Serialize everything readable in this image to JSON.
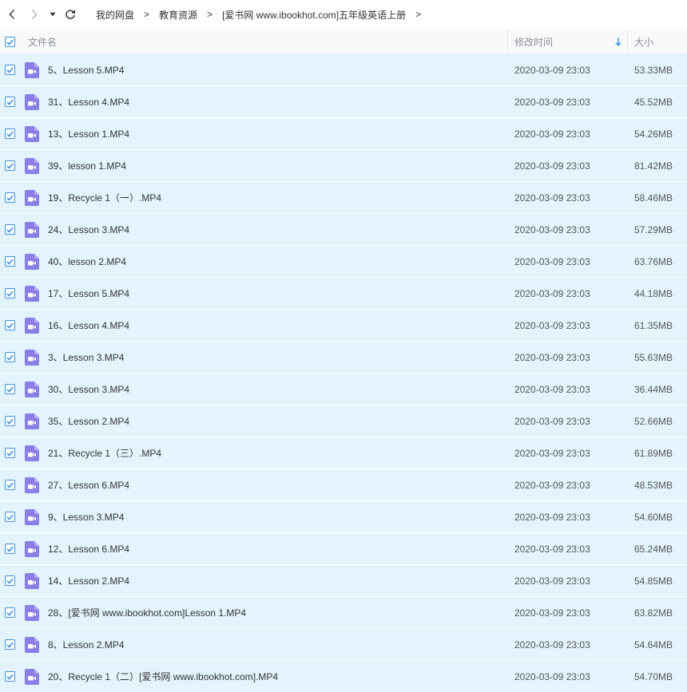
{
  "nav": {
    "back_icon": "chevron-left-icon",
    "forward_icon": "chevron-right-icon",
    "history_icon": "caret-down-icon",
    "refresh_icon": "refresh-icon"
  },
  "breadcrumb": {
    "items": [
      "我的网盘",
      "教育资源",
      "[爱书网 www.ibookhot.com]五年级英语上册"
    ],
    "separator": ">"
  },
  "columns": {
    "name": "文件名",
    "mtime": "修改时间",
    "size": "大小",
    "sort_icon": "arrow-down-icon"
  },
  "colors": {
    "row_selected_bg": "#e3f4fd",
    "checkbox": "#3b8fe0",
    "video_icon": "#8a7fe6",
    "sort_arrow": "#3b8fe0"
  },
  "files": [
    {
      "name": "5、Lesson 5.MP4",
      "mtime": "2020-03-09 23:03",
      "size": "53.33MB"
    },
    {
      "name": "31、Lesson 4.MP4",
      "mtime": "2020-03-09 23:03",
      "size": "45.52MB"
    },
    {
      "name": "13、Lesson 1.MP4",
      "mtime": "2020-03-09 23:03",
      "size": "54.26MB"
    },
    {
      "name": "39、lesson 1.MP4",
      "mtime": "2020-03-09 23:03",
      "size": "81.42MB"
    },
    {
      "name": "19、Recycle 1（一）.MP4",
      "mtime": "2020-03-09 23:03",
      "size": "58.46MB"
    },
    {
      "name": "24、Lesson 3.MP4",
      "mtime": "2020-03-09 23:03",
      "size": "57.29MB"
    },
    {
      "name": "40、lesson 2.MP4",
      "mtime": "2020-03-09 23:03",
      "size": "63.76MB"
    },
    {
      "name": "17、Lesson 5.MP4",
      "mtime": "2020-03-09 23:03",
      "size": "44.18MB"
    },
    {
      "name": "16、Lesson 4.MP4",
      "mtime": "2020-03-09 23:03",
      "size": "61.35MB"
    },
    {
      "name": "3、Lesson 3.MP4",
      "mtime": "2020-03-09 23:03",
      "size": "55.63MB"
    },
    {
      "name": "30、Lesson 3.MP4",
      "mtime": "2020-03-09 23:03",
      "size": "36.44MB"
    },
    {
      "name": "35、Lesson 2.MP4",
      "mtime": "2020-03-09 23:03",
      "size": "52.66MB"
    },
    {
      "name": "21、Recycle 1（三）.MP4",
      "mtime": "2020-03-09 23:03",
      "size": "61.89MB"
    },
    {
      "name": "27、Lesson 6.MP4",
      "mtime": "2020-03-09 23:03",
      "size": "48.53MB"
    },
    {
      "name": "9、Lesson 3.MP4",
      "mtime": "2020-03-09 23:03",
      "size": "54.60MB"
    },
    {
      "name": "12、Lesson 6.MP4",
      "mtime": "2020-03-09 23:03",
      "size": "65.24MB"
    },
    {
      "name": "14、Lesson 2.MP4",
      "mtime": "2020-03-09 23:03",
      "size": "54.85MB"
    },
    {
      "name": "28、[爱书网 www.ibookhot.com]Lesson 1.MP4",
      "mtime": "2020-03-09 23:03",
      "size": "63.82MB"
    },
    {
      "name": "8、Lesson 2.MP4",
      "mtime": "2020-03-09 23:03",
      "size": "54.64MB"
    },
    {
      "name": "20、Recycle 1（二）[爱书网 www.ibookhot.com].MP4",
      "mtime": "2020-03-09 23:03",
      "size": "54.70MB"
    }
  ]
}
